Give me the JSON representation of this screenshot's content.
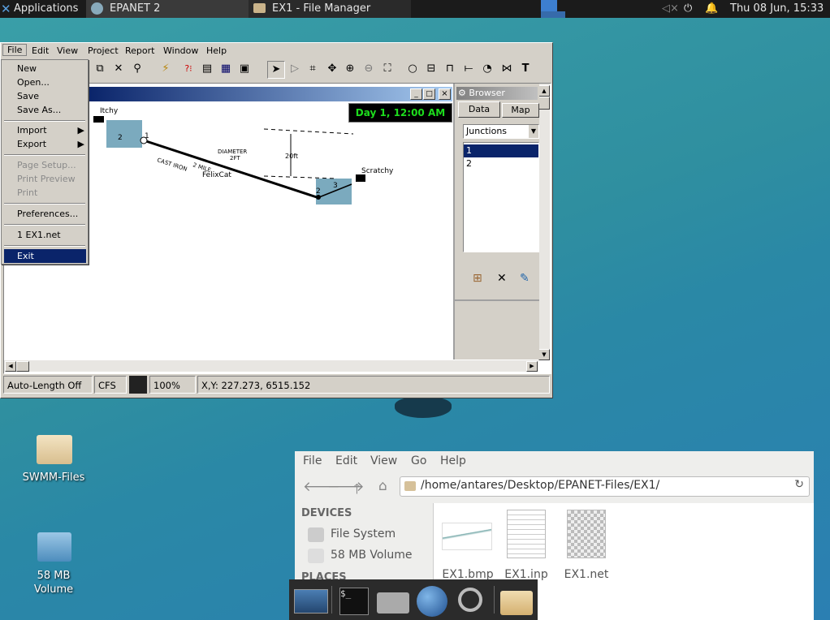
{
  "top_panel": {
    "applications": "Applications",
    "task1": "EPANET 2",
    "task2": "EX1 - File Manager",
    "clock": "Thu 08 Jun, 15:33"
  },
  "epanet": {
    "menus": [
      "File",
      "Edit",
      "View",
      "Project",
      "Report",
      "Window",
      "Help"
    ],
    "map_time": "Day 1, 12:00 AM",
    "labels": {
      "itchy": "Itchy",
      "scratchy": "Scratchy",
      "felixcat": "FelixCat",
      "diameter": "DIAMETER",
      "two_ft": "2FT",
      "twenty_ft": "20ft",
      "cast_iron": "CAST IRON",
      "two_mile": "2 MILE",
      "n1": "1",
      "n2": "2",
      "n3": "3",
      "n2b": "2"
    },
    "browser": {
      "title": "Browser",
      "tabs": [
        "Data",
        "Map"
      ],
      "select": "Junctions",
      "items": [
        "1",
        "2"
      ]
    },
    "status": {
      "autolength": "Auto-Length Off",
      "units": "CFS",
      "zoom": "100%",
      "coords": "X,Y: 227.273, 6515.152"
    }
  },
  "file_menu": {
    "new": "New",
    "open": "Open...",
    "save": "Save",
    "saveas": "Save As...",
    "import": "Import",
    "export": "Export",
    "pagesetup": "Page Setup...",
    "printpreview": "Print Preview",
    "print": "Print",
    "preferences": "Preferences...",
    "recent": "1 EX1.net",
    "exit": "Exit"
  },
  "desktop": {
    "icon1": "SWMM-Files",
    "icon2_line1": "58 MB",
    "icon2_line2": "Volume"
  },
  "file_manager": {
    "menus": [
      "File",
      "Edit",
      "View",
      "Go",
      "Help"
    ],
    "path": "/home/antares/Desktop/EPANET-Files/EX1/",
    "devices_heading": "DEVICES",
    "devices": [
      "File System",
      "58 MB Volume"
    ],
    "places_heading": "PLACES",
    "files": [
      "EX1.bmp",
      "EX1.inp",
      "EX1.net"
    ]
  }
}
